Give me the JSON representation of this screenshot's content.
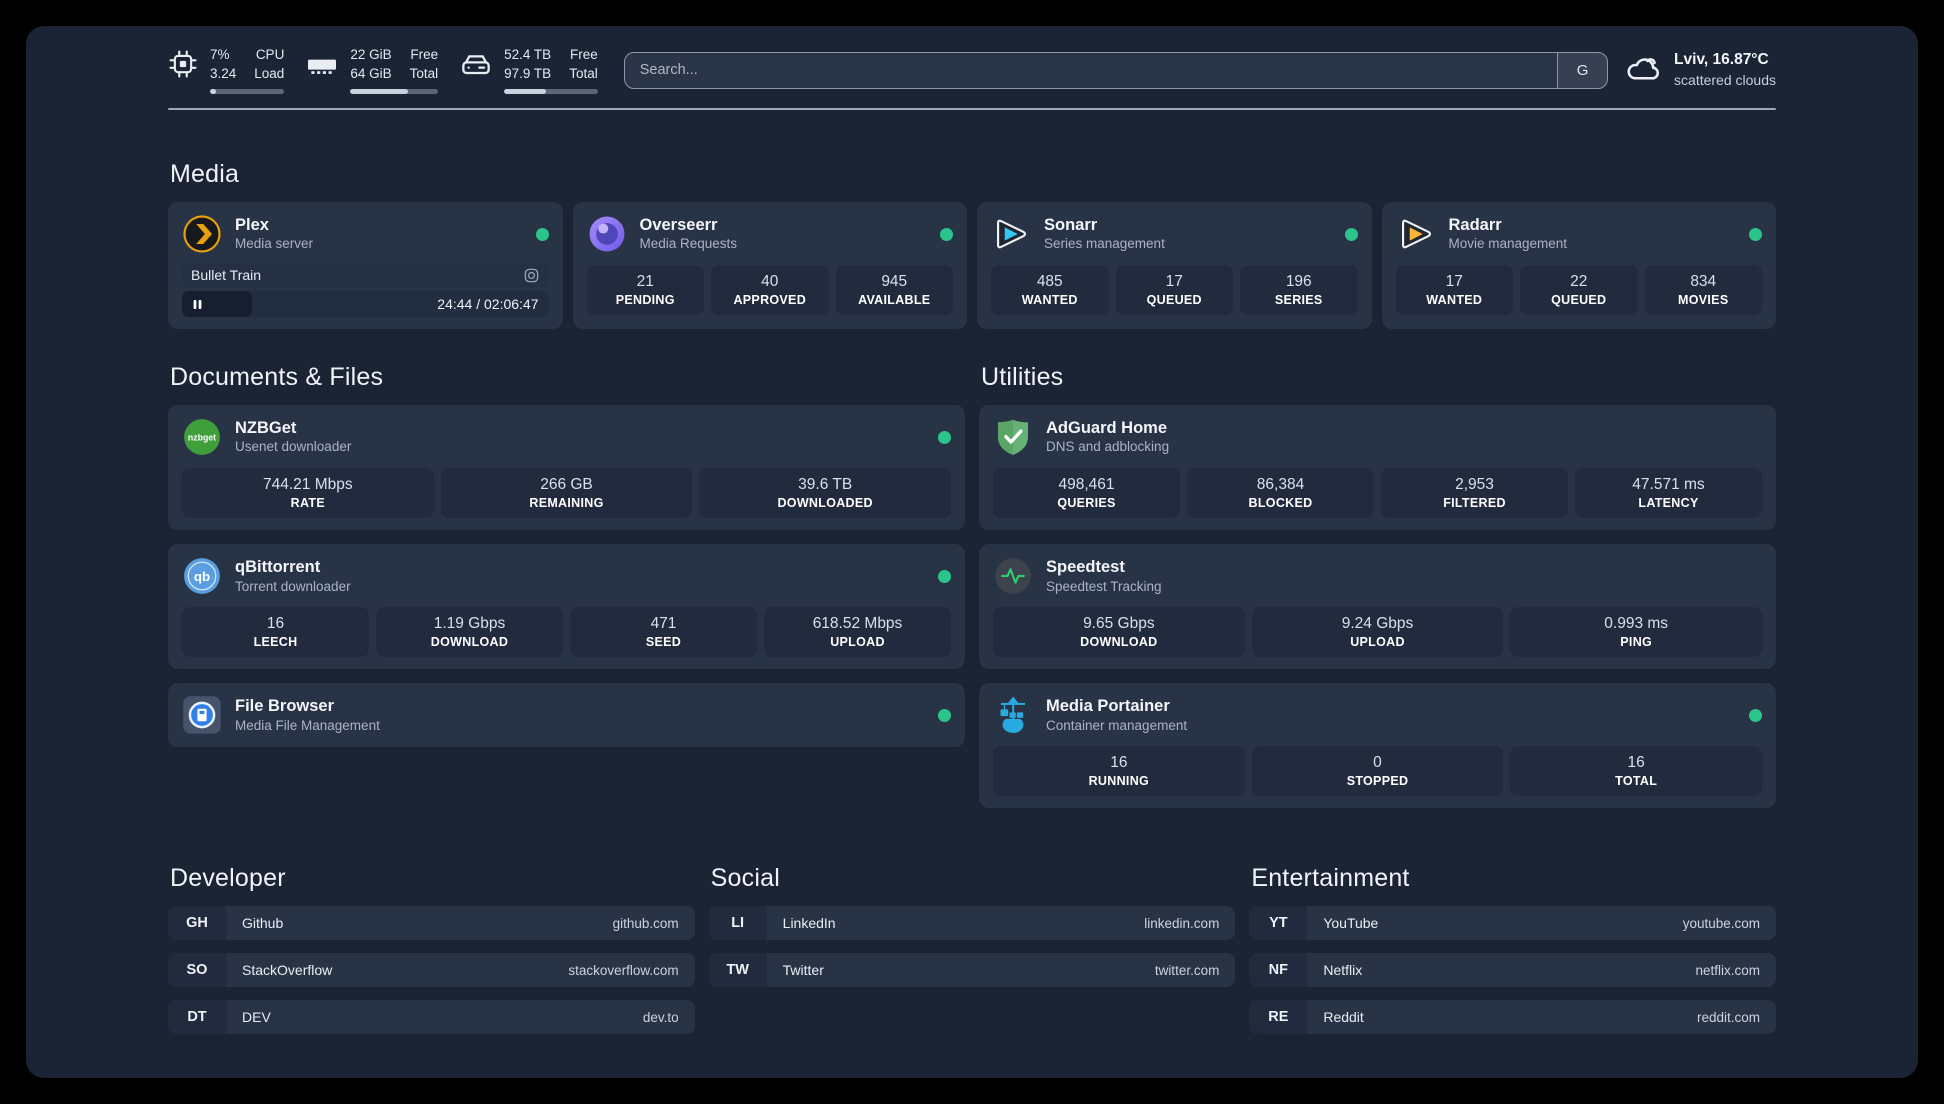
{
  "colors": {
    "status_online": "#2bc48a"
  },
  "topbar": {
    "cpu": {
      "icon": "cpu-chip-icon",
      "values": [
        "7%",
        "3.24"
      ],
      "labels": [
        "CPU",
        "Load"
      ],
      "bar_percent": 8
    },
    "memory": {
      "icon": "ram-icon",
      "values": [
        "22 GiB",
        "64 GiB"
      ],
      "labels": [
        "Free",
        "Total"
      ],
      "bar_percent": 66
    },
    "storage": {
      "icon": "hard-drive-icon",
      "values": [
        "52.4 TB",
        "97.9 TB"
      ],
      "labels": [
        "Free",
        "Total"
      ],
      "bar_percent": 45
    },
    "search": {
      "placeholder": "Search...",
      "engine_button_label": "G"
    },
    "weather": {
      "icon": "cloud-icon",
      "location_temperature": "Lviv, 16.87°C",
      "condition": "scattered clouds"
    }
  },
  "media": {
    "section_title": "Media",
    "plex": {
      "name": "Plex",
      "description": "Media server",
      "status": "online",
      "now_playing": {
        "title": "Bullet Train",
        "elapsed_total": "24:44 / 02:06:47",
        "progress_percent": 19
      }
    },
    "overseerr": {
      "name": "Overseerr",
      "description": "Media Requests",
      "status": "online",
      "stats": [
        {
          "value": "21",
          "label": "PENDING"
        },
        {
          "value": "40",
          "label": "APPROVED"
        },
        {
          "value": "945",
          "label": "AVAILABLE"
        }
      ]
    },
    "sonarr": {
      "name": "Sonarr",
      "description": "Series management",
      "status": "online",
      "stats": [
        {
          "value": "485",
          "label": "WANTED"
        },
        {
          "value": "17",
          "label": "QUEUED"
        },
        {
          "value": "196",
          "label": "SERIES"
        }
      ]
    },
    "radarr": {
      "name": "Radarr",
      "description": "Movie management",
      "status": "online",
      "stats": [
        {
          "value": "17",
          "label": "WANTED"
        },
        {
          "value": "22",
          "label": "QUEUED"
        },
        {
          "value": "834",
          "label": "MOVIES"
        }
      ]
    }
  },
  "documents": {
    "section_title": "Documents & Files",
    "nzbget": {
      "name": "NZBGet",
      "description": "Usenet downloader",
      "status": "online",
      "stats": [
        {
          "value": "744.21 Mbps",
          "label": "RATE"
        },
        {
          "value": "266 GB",
          "label": "REMAINING"
        },
        {
          "value": "39.6 TB",
          "label": "DOWNLOADED"
        }
      ]
    },
    "qbittorrent": {
      "name": "qBittorrent",
      "description": "Torrent downloader",
      "status": "online",
      "stats": [
        {
          "value": "16",
          "label": "LEECH"
        },
        {
          "value": "1.19 Gbps",
          "label": "DOWNLOAD"
        },
        {
          "value": "471",
          "label": "SEED"
        },
        {
          "value": "618.52 Mbps",
          "label": "UPLOAD"
        }
      ]
    },
    "filebrowser": {
      "name": "File Browser",
      "description": "Media File Management",
      "status": "online"
    }
  },
  "utilities": {
    "section_title": "Utilities",
    "adguard": {
      "name": "AdGuard Home",
      "description": "DNS and adblocking",
      "stats": [
        {
          "value": "498,461",
          "label": "QUERIES"
        },
        {
          "value": "86,384",
          "label": "BLOCKED"
        },
        {
          "value": "2,953",
          "label": "FILTERED"
        },
        {
          "value": "47.571 ms",
          "label": "LATENCY"
        }
      ]
    },
    "speedtest": {
      "name": "Speedtest",
      "description": "Speedtest Tracking",
      "stats": [
        {
          "value": "9.65 Gbps",
          "label": "DOWNLOAD"
        },
        {
          "value": "9.24 Gbps",
          "label": "UPLOAD"
        },
        {
          "value": "0.993 ms",
          "label": "PING"
        }
      ]
    },
    "portainer": {
      "name": "Media Portainer",
      "description": "Container management",
      "status": "online",
      "stats": [
        {
          "value": "16",
          "label": "RUNNING"
        },
        {
          "value": "0",
          "label": "STOPPED"
        },
        {
          "value": "16",
          "label": "TOTAL"
        }
      ]
    }
  },
  "bookmarks": {
    "developer": {
      "section_title": "Developer",
      "items": [
        {
          "abbr": "GH",
          "name": "Github",
          "url": "github.com"
        },
        {
          "abbr": "SO",
          "name": "StackOverflow",
          "url": "stackoverflow.com"
        },
        {
          "abbr": "DT",
          "name": "DEV",
          "url": "dev.to"
        }
      ]
    },
    "social": {
      "section_title": "Social",
      "items": [
        {
          "abbr": "LI",
          "name": "LinkedIn",
          "url": "linkedin.com"
        },
        {
          "abbr": "TW",
          "name": "Twitter",
          "url": "twitter.com"
        }
      ]
    },
    "entertainment": {
      "section_title": "Entertainment",
      "items": [
        {
          "abbr": "YT",
          "name": "YouTube",
          "url": "youtube.com"
        },
        {
          "abbr": "NF",
          "name": "Netflix",
          "url": "netflix.com"
        },
        {
          "abbr": "RE",
          "name": "Reddit",
          "url": "reddit.com"
        }
      ]
    }
  }
}
